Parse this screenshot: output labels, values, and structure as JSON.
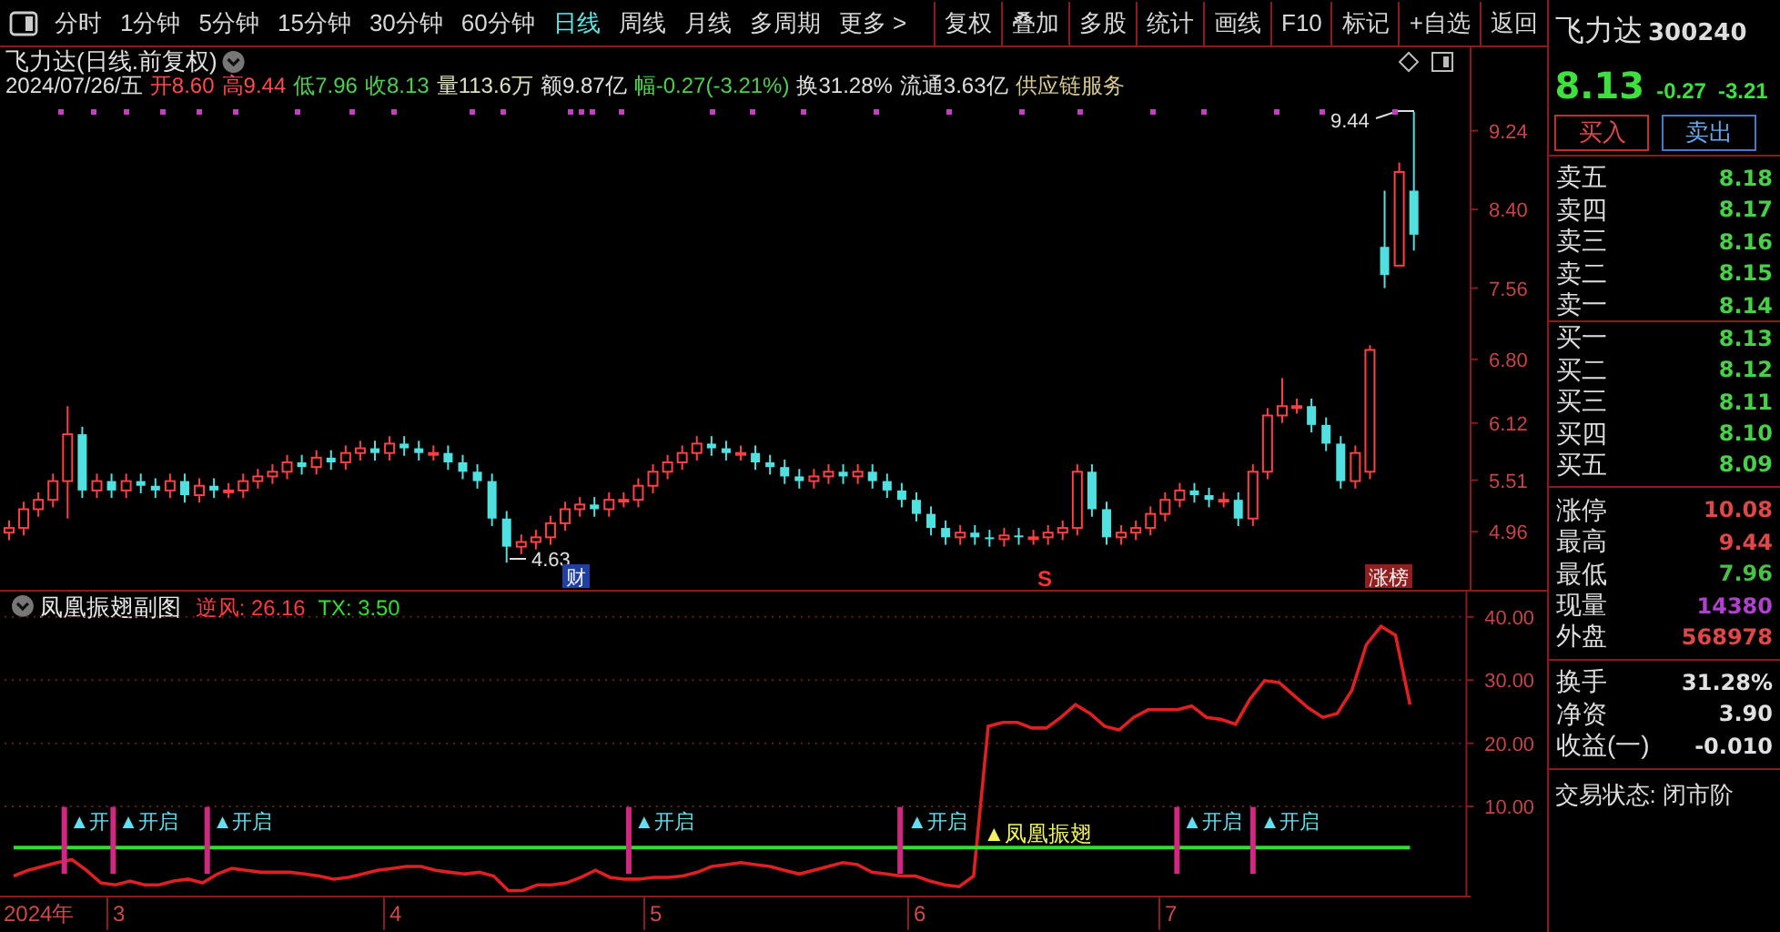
{
  "toolbar": {
    "period_tabs": [
      {
        "label": "分时",
        "selected": false
      },
      {
        "label": "1分钟",
        "selected": false
      },
      {
        "label": "5分钟",
        "selected": false
      },
      {
        "label": "15分钟",
        "selected": false
      },
      {
        "label": "30分钟",
        "selected": false
      },
      {
        "label": "60分钟",
        "selected": false
      },
      {
        "label": "日线",
        "selected": true
      },
      {
        "label": "周线",
        "selected": false
      },
      {
        "label": "月线",
        "selected": false
      },
      {
        "label": "多周期",
        "selected": false
      },
      {
        "label": "更多 >",
        "selected": false
      }
    ],
    "buttons": [
      "复权",
      "叠加",
      "多股",
      "统计",
      "画线",
      "F10",
      "标记",
      "+自选",
      "返回"
    ]
  },
  "price_chart": {
    "title": "飞力达(日线.前复权)",
    "info": [
      {
        "text": "2024/07/26/五",
        "color": "#e0e0e0"
      },
      {
        "text": "开8.60",
        "color": "#ff4a4a"
      },
      {
        "text": "高9.44",
        "color": "#ff4a4a"
      },
      {
        "text": "低7.96",
        "color": "#4cd04c"
      },
      {
        "text": "收8.13",
        "color": "#4cd04c"
      },
      {
        "text": "量113.6万",
        "color": "#e0e0c0"
      },
      {
        "text": "额9.87亿",
        "color": "#e0e0e0"
      },
      {
        "text": "幅-0.27(-3.21%)",
        "color": "#4cd04c"
      },
      {
        "text": "换31.28%",
        "color": "#e0e0e0"
      },
      {
        "text": "流通3.63亿",
        "color": "#e0e0e0"
      },
      {
        "text": "供应链服务",
        "color": "#d8c890"
      }
    ],
    "annotations": [
      {
        "kind": "value",
        "text": "9.44"
      },
      {
        "kind": "value",
        "text": "4.63"
      },
      {
        "kind": "tag",
        "text": "财"
      },
      {
        "kind": "signal",
        "text": "S"
      },
      {
        "kind": "tag",
        "text": "涨榜"
      }
    ],
    "chart_data": {
      "type": "candlestick",
      "ylim": [
        4.34,
        10.13
      ],
      "yticks": [
        {
          "value": 9.24,
          "label": "9.24"
        },
        {
          "value": 8.4,
          "label": "8.40"
        },
        {
          "value": 7.56,
          "label": "7.56"
        },
        {
          "value": 6.8,
          "label": "6.80"
        },
        {
          "value": 6.12,
          "label": "6.12"
        },
        {
          "value": 5.51,
          "label": "5.51"
        },
        {
          "value": 4.96,
          "label": "4.96"
        }
      ],
      "ohlc": [
        [
          4.95,
          5.08,
          4.87,
          5.0
        ],
        [
          5.0,
          5.28,
          4.92,
          5.2
        ],
        [
          5.2,
          5.38,
          5.12,
          5.3
        ],
        [
          5.3,
          5.58,
          5.22,
          5.5
        ],
        [
          5.5,
          6.3,
          5.1,
          6.0
        ],
        [
          6.0,
          6.08,
          5.32,
          5.4
        ],
        [
          5.4,
          5.58,
          5.32,
          5.5
        ],
        [
          5.5,
          5.58,
          5.32,
          5.4
        ],
        [
          5.4,
          5.58,
          5.32,
          5.5
        ],
        [
          5.5,
          5.58,
          5.37,
          5.45
        ],
        [
          5.45,
          5.53,
          5.32,
          5.4
        ],
        [
          5.4,
          5.58,
          5.32,
          5.5
        ],
        [
          5.5,
          5.58,
          5.27,
          5.35
        ],
        [
          5.35,
          5.53,
          5.27,
          5.45
        ],
        [
          5.45,
          5.53,
          5.32,
          5.4
        ],
        [
          5.4,
          5.48,
          5.32,
          5.4
        ],
        [
          5.4,
          5.58,
          5.32,
          5.5
        ],
        [
          5.5,
          5.63,
          5.42,
          5.55
        ],
        [
          5.55,
          5.68,
          5.47,
          5.6
        ],
        [
          5.6,
          5.78,
          5.52,
          5.7
        ],
        [
          5.7,
          5.78,
          5.57,
          5.65
        ],
        [
          5.65,
          5.83,
          5.57,
          5.75
        ],
        [
          5.75,
          5.83,
          5.62,
          5.7
        ],
        [
          5.7,
          5.88,
          5.62,
          5.8
        ],
        [
          5.8,
          5.93,
          5.72,
          5.85
        ],
        [
          5.85,
          5.93,
          5.72,
          5.8
        ],
        [
          5.8,
          5.98,
          5.72,
          5.9
        ],
        [
          5.9,
          5.98,
          5.77,
          5.85
        ],
        [
          5.85,
          5.93,
          5.72,
          5.8
        ],
        [
          5.8,
          5.88,
          5.72,
          5.8
        ],
        [
          5.8,
          5.88,
          5.62,
          5.7
        ],
        [
          5.7,
          5.78,
          5.52,
          5.6
        ],
        [
          5.6,
          5.68,
          5.42,
          5.5
        ],
        [
          5.5,
          5.58,
          5.02,
          5.1
        ],
        [
          5.1,
          5.18,
          4.63,
          4.8
        ],
        [
          4.8,
          4.93,
          4.72,
          4.85
        ],
        [
          4.85,
          4.98,
          4.77,
          4.9
        ],
        [
          4.9,
          5.13,
          4.82,
          5.05
        ],
        [
          5.05,
          5.28,
          4.97,
          5.2
        ],
        [
          5.2,
          5.33,
          5.12,
          5.25
        ],
        [
          5.25,
          5.33,
          5.12,
          5.2
        ],
        [
          5.2,
          5.38,
          5.12,
          5.3
        ],
        [
          5.3,
          5.38,
          5.22,
          5.3
        ],
        [
          5.3,
          5.53,
          5.22,
          5.45
        ],
        [
          5.45,
          5.68,
          5.37,
          5.6
        ],
        [
          5.6,
          5.78,
          5.52,
          5.7
        ],
        [
          5.7,
          5.88,
          5.62,
          5.8
        ],
        [
          5.8,
          5.98,
          5.72,
          5.9
        ],
        [
          5.9,
          5.98,
          5.77,
          5.85
        ],
        [
          5.85,
          5.93,
          5.72,
          5.8
        ],
        [
          5.8,
          5.88,
          5.72,
          5.8
        ],
        [
          5.8,
          5.88,
          5.62,
          5.7
        ],
        [
          5.7,
          5.78,
          5.57,
          5.65
        ],
        [
          5.65,
          5.73,
          5.47,
          5.55
        ],
        [
          5.55,
          5.63,
          5.42,
          5.5
        ],
        [
          5.5,
          5.63,
          5.42,
          5.55
        ],
        [
          5.55,
          5.68,
          5.47,
          5.6
        ],
        [
          5.6,
          5.68,
          5.47,
          5.55
        ],
        [
          5.55,
          5.68,
          5.47,
          5.6
        ],
        [
          5.6,
          5.68,
          5.42,
          5.5
        ],
        [
          5.5,
          5.58,
          5.32,
          5.4
        ],
        [
          5.4,
          5.48,
          5.22,
          5.3
        ],
        [
          5.3,
          5.38,
          5.07,
          5.15
        ],
        [
          5.15,
          5.23,
          4.92,
          5.0
        ],
        [
          5.0,
          5.08,
          4.82,
          4.9
        ],
        [
          4.9,
          5.03,
          4.82,
          4.95
        ],
        [
          4.95,
          5.03,
          4.82,
          4.9
        ],
        [
          4.9,
          4.98,
          4.8,
          4.88
        ],
        [
          4.88,
          5.0,
          4.8,
          4.92
        ],
        [
          4.92,
          5.0,
          4.82,
          4.9
        ],
        [
          4.9,
          4.98,
          4.82,
          4.9
        ],
        [
          4.9,
          5.03,
          4.82,
          4.95
        ],
        [
          4.95,
          5.08,
          4.87,
          5.0
        ],
        [
          5.0,
          5.68,
          4.92,
          5.6
        ],
        [
          5.6,
          5.68,
          5.12,
          5.2
        ],
        [
          5.2,
          5.28,
          4.82,
          4.9
        ],
        [
          4.9,
          5.03,
          4.82,
          4.95
        ],
        [
          4.95,
          5.08,
          4.87,
          5.0
        ],
        [
          5.0,
          5.23,
          4.92,
          5.15
        ],
        [
          5.15,
          5.38,
          5.07,
          5.3
        ],
        [
          5.3,
          5.48,
          5.22,
          5.4
        ],
        [
          5.4,
          5.48,
          5.27,
          5.35
        ],
        [
          5.35,
          5.43,
          5.22,
          5.3
        ],
        [
          5.3,
          5.38,
          5.22,
          5.3
        ],
        [
          5.3,
          5.38,
          5.02,
          5.1
        ],
        [
          5.1,
          5.68,
          5.02,
          5.6
        ],
        [
          5.6,
          6.28,
          5.52,
          6.2
        ],
        [
          6.2,
          6.6,
          6.12,
          6.3
        ],
        [
          6.3,
          6.38,
          6.22,
          6.3
        ],
        [
          6.3,
          6.38,
          6.02,
          6.1
        ],
        [
          6.1,
          6.18,
          5.82,
          5.9
        ],
        [
          5.9,
          5.98,
          5.42,
          5.5
        ],
        [
          5.5,
          5.88,
          5.42,
          5.8
        ],
        [
          5.6,
          6.95,
          5.52,
          6.9
        ],
        [
          8.0,
          8.6,
          7.56,
          7.7
        ],
        [
          7.8,
          8.9,
          7.8,
          8.8
        ],
        [
          8.6,
          9.44,
          7.96,
          8.13
        ]
      ]
    }
  },
  "indicator": {
    "title": "凤凰振翅副图",
    "readings": [
      ": 26.16",
      ": 3.50"
    ],
    "markers": [
      {
        "kind": "open",
        "text": "▲开"
      },
      {
        "kind": "open",
        "text": "▲开启"
      },
      {
        "kind": "open",
        "text": "▲开启"
      },
      {
        "kind": "open",
        "text": "▲开启"
      },
      {
        "kind": "open",
        "text": "▲开启"
      },
      {
        "kind": "signal",
        "text": "▲凤凰振翅"
      },
      {
        "kind": "open",
        "text": "▲开启"
      },
      {
        "kind": "open",
        "text": "▲开启"
      }
    ],
    "chart_data": {
      "type": "line",
      "ylim": [
        -4.1,
        44
      ],
      "grid": true,
      "yticks": [
        {
          "value": 10,
          "label": "10.00"
        },
        {
          "value": 20,
          "label": "20.00"
        },
        {
          "value": 30,
          "label": "30.00"
        },
        {
          "value": 40,
          "label": "40.00"
        }
      ],
      "series": [
        {
          "name": "逆风",
          "color": "#e02020",
          "values": [
            -1.0,
            -0.1,
            0.5,
            1.1,
            1.6,
            -0.1,
            -2.1,
            -2.4,
            -1.8,
            -2.4,
            -2.4,
            -1.8,
            -1.5,
            -2.1,
            -0.7,
            0.2,
            -0.1,
            -0.4,
            -0.4,
            -0.4,
            -0.7,
            -1.0,
            -1.5,
            -1.2,
            -0.7,
            -0.1,
            0.2,
            0.5,
            0.5,
            -0.1,
            -0.4,
            -0.7,
            -0.4,
            -1.0,
            -3.3,
            -3.3,
            -2.4,
            -2.4,
            -2.1,
            -1.2,
            -0.1,
            -1.2,
            -1.5,
            -1.5,
            -1.2,
            -1.2,
            -1.0,
            -0.4,
            0.5,
            0.8,
            1.1,
            0.8,
            0.5,
            -0.1,
            -0.7,
            -0.1,
            0.5,
            1.1,
            0.8,
            -0.4,
            -0.7,
            -1.0,
            -1.0,
            -1.8,
            -2.4,
            -2.7,
            -1.0,
            22.7,
            23.3,
            23.3,
            22.4,
            22.4,
            24.1,
            26.1,
            24.7,
            22.7,
            22.1,
            24.1,
            25.3,
            25.3,
            25.3,
            25.9,
            24.1,
            23.8,
            23.0,
            27.0,
            29.9,
            29.6,
            27.6,
            25.6,
            24.1,
            24.7,
            28.4,
            35.6,
            38.5,
            37.1,
            26.1
          ]
        },
        {
          "name": "TX",
          "color": "#30e030",
          "values": [
            3.5,
            3.5,
            3.5,
            3.5,
            3.5,
            3.5,
            3.5,
            3.5,
            3.5,
            3.5,
            3.5,
            3.5,
            3.5,
            3.5,
            3.5,
            3.5,
            3.5,
            3.5,
            3.5,
            3.5,
            3.5,
            3.5,
            3.5,
            3.5,
            3.5,
            3.5,
            3.5,
            3.5,
            3.5,
            3.5,
            3.5,
            3.5,
            3.5,
            3.5,
            3.5,
            3.5,
            3.5,
            3.5,
            3.5,
            3.5,
            3.5,
            3.5,
            3.5,
            3.5,
            3.5,
            3.5,
            3.5,
            3.5,
            3.5,
            3.5,
            3.5,
            3.5,
            3.5,
            3.5,
            3.5,
            3.5,
            3.5,
            3.5,
            3.5,
            3.5,
            3.5,
            3.5,
            3.5,
            3.5,
            3.5,
            3.5,
            3.5,
            3.5,
            3.5,
            3.5,
            3.5,
            3.5,
            3.5,
            3.5,
            3.5,
            3.5,
            3.5,
            3.5,
            3.5,
            3.5,
            3.5,
            3.5,
            3.5,
            3.5,
            3.5,
            3.5,
            3.5,
            3.5,
            3.5,
            3.5,
            3.5,
            3.5,
            3.5,
            3.5,
            3.5,
            3.5,
            3.5
          ]
        }
      ]
    }
  },
  "time_axis": [
    "2024年",
    "3",
    "4",
    "5",
    "6",
    "7"
  ],
  "quote_panel": {
    "name": "飞力达",
    "code": "300240",
    "price": "8.13",
    "change": "-0.27",
    "change_pct": "-3.21",
    "trade_buttons": [
      {
        "kind": "buy",
        "label": "买入"
      },
      {
        "kind": "sell",
        "label": "卖出"
      }
    ],
    "order_book": [
      {
        "label": "卖五",
        "price": "8.18"
      },
      {
        "label": "卖四",
        "price": "8.17"
      },
      {
        "label": "卖三",
        "price": "8.16"
      },
      {
        "label": "卖二",
        "price": "8.15"
      },
      {
        "label": "卖一",
        "price": "8.14"
      },
      {
        "label": "买一",
        "price": "8.13"
      },
      {
        "label": "买二",
        "price": "8.12"
      },
      {
        "label": "买三",
        "price": "8.11"
      },
      {
        "label": "买四",
        "price": "8.10"
      },
      {
        "label": "买五",
        "price": "8.09"
      }
    ],
    "stats": [
      {
        "label": "涨停",
        "value": "10.08",
        "color": "#e04848"
      },
      {
        "label": "最高",
        "value": "9.44",
        "color": "#e04848"
      },
      {
        "label": "最低",
        "value": "7.96",
        "color": "#48c048"
      },
      {
        "label": "现量",
        "value": "14380",
        "color": "#b040d0"
      },
      {
        "label": "外盘",
        "value": "568978",
        "color": "#e04848"
      }
    ],
    "stats_2": [
      {
        "label": "换手",
        "value": "31.28%"
      },
      {
        "label": "净资",
        "value": "3.90"
      },
      {
        "label": "收益(一)",
        "value": "-0.010"
      }
    ],
    "status": "交易状态: 闭市阶"
  }
}
